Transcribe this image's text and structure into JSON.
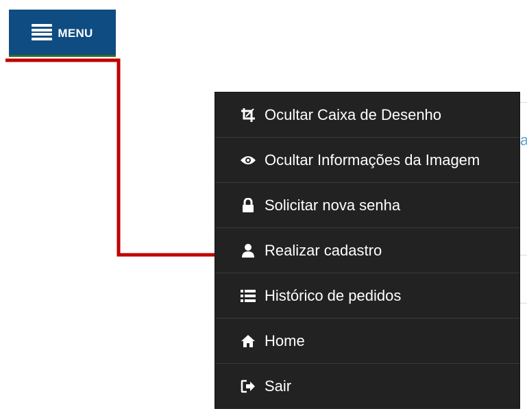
{
  "menu_button": {
    "label": "MENU",
    "icon": "hamburger-icon",
    "background": "#0f4c81"
  },
  "annotation": {
    "color": "#c00000"
  },
  "background_fragment": "a",
  "dropdown": {
    "background": "#222222",
    "items": [
      {
        "label": "Ocultar Caixa de Desenho",
        "icon": "crop-icon"
      },
      {
        "label": "Ocultar Informações da Imagem",
        "icon": "eye-icon"
      },
      {
        "label": "Solicitar nova senha",
        "icon": "lock-icon"
      },
      {
        "label": "Realizar cadastro",
        "icon": "user-icon"
      },
      {
        "label": "Histórico de pedidos",
        "icon": "list-icon"
      },
      {
        "label": "Home",
        "icon": "home-icon"
      },
      {
        "label": "Sair",
        "icon": "sign-out-icon"
      }
    ]
  }
}
